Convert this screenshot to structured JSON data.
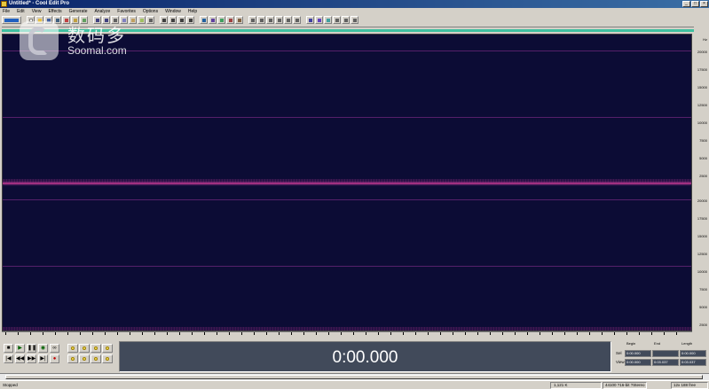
{
  "window": {
    "title": "Untitled* - Cool Edit Pro"
  },
  "menu": [
    "File",
    "Edit",
    "View",
    "Effects",
    "Generate",
    "Analyze",
    "Favorites",
    "Options",
    "Window",
    "Help"
  ],
  "watermark": {
    "cn": "数码多",
    "en": "Soomal.com"
  },
  "time_display": {
    "value": "0:00.000"
  },
  "selection_panel": {
    "headers": [
      "Begin",
      "End",
      "Length"
    ],
    "rows": [
      {
        "label": "Sel",
        "begin": "0:00.000",
        "end": "",
        "length": "0:00.000"
      },
      {
        "label": "View",
        "begin": "0:00.000",
        "end": "0:03.037",
        "length": "0:03.037"
      }
    ]
  },
  "status": {
    "left": "Stopped",
    "sample_info": "44100 ?16-bit ?Stereo",
    "level": "1,121 K",
    "free": "12x 188 free"
  },
  "colors": {
    "spectral_bg": "#0c0c35",
    "time_bg": "#414a5a",
    "overview": "#3fc0a0",
    "title_bar": "#0a246a"
  }
}
